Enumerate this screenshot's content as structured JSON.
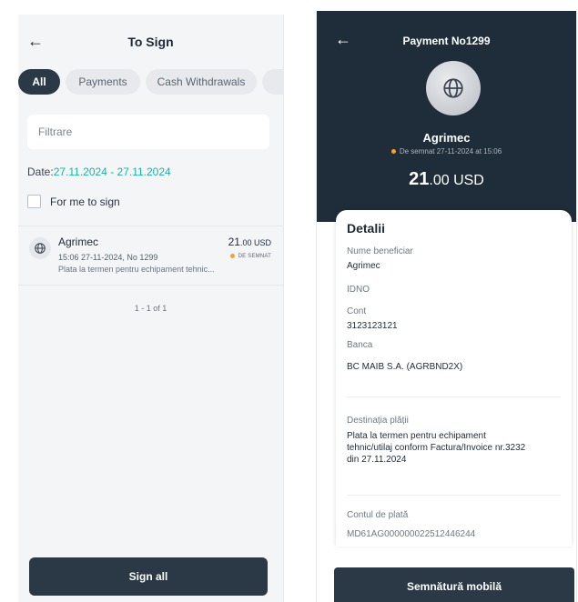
{
  "left": {
    "header": {
      "title": "To Sign"
    },
    "tabs": [
      {
        "label": "All"
      },
      {
        "label": "Payments"
      },
      {
        "label": "Cash Withdrawals"
      }
    ],
    "filter": {
      "placeholder": "Filtrare"
    },
    "date": {
      "label": "Date:",
      "range": "27.11.2024 - 27.11.2024"
    },
    "checkbox": {
      "label": "For me to sign",
      "checked": false
    },
    "item": {
      "name": "Agrimec",
      "amount_int": "21",
      "amount_rest": ".00 USD",
      "meta": "15:06 27-11-2024, No 1299",
      "description": "Plata la termen pentru echipament tehnic...",
      "status": "DE SEMNAT",
      "status_color": "#f5a524"
    },
    "pager": "1 - 1 of 1",
    "sign_all": "Sign all"
  },
  "right": {
    "header": {
      "title": "Payment No1299"
    },
    "company": "Agrimec",
    "status_text": "De semnat  27-11-2024 at 15:06",
    "amount_int": "21",
    "amount_rest": ".00 USD",
    "details": {
      "title": "Detalii",
      "beneficiary_label": "Nume beneficiar",
      "beneficiary_value": "Agrimec",
      "idno_label": "IDNO",
      "account_label": "Cont",
      "account_value": "3123123121",
      "bank_label": "Banca",
      "bank_value": "BC MAIB S.A. (AGRBND2X)",
      "purpose_label": "Destinația plății",
      "purpose_line1": "Plata la termen pentru echipament",
      "purpose_line2": "tehnic/utilaj conform Factura/Invoice nr.3232",
      "purpose_line3": "din 27.11.2024",
      "payer_account_label": "Contul de plată",
      "payer_account_value": "MD61AG000000022512446244"
    },
    "button": "Semnătură mobilă"
  },
  "colors": {
    "dark": "#2b3846",
    "accent_green": "#19b59d",
    "status_orange": "#f5a524",
    "header_dark": "#1f2d3a"
  }
}
